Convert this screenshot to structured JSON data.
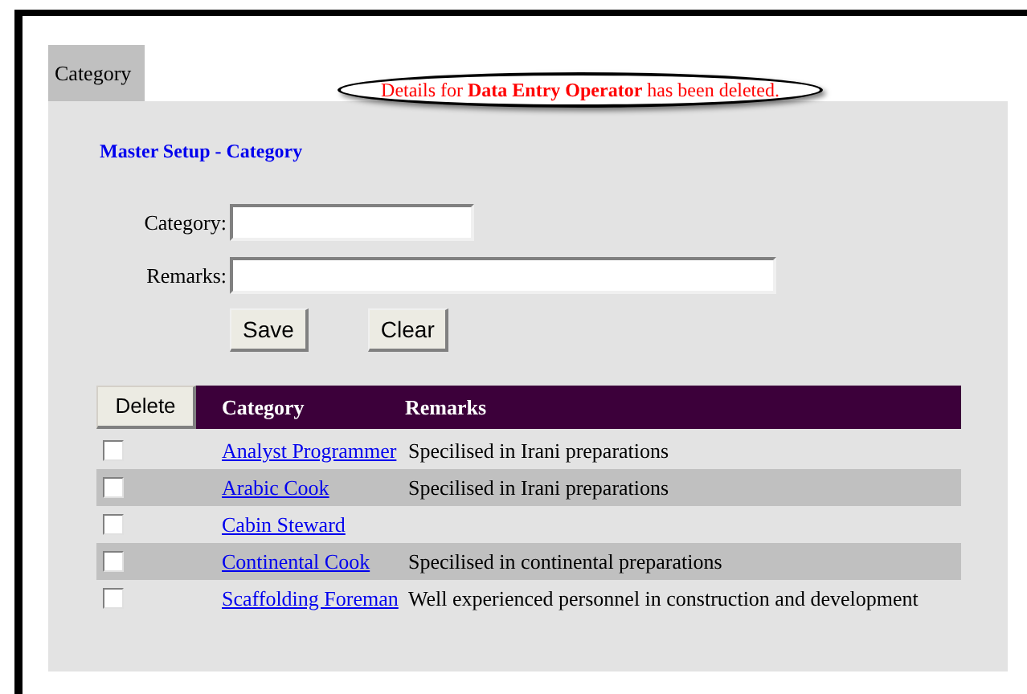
{
  "tabs": [
    {
      "label": "Category",
      "selected": true
    }
  ],
  "message": "Details for **Data Entry Operator** has been deleted.",
  "form": {
    "title": "Master Setup - Category",
    "fields": [
      {
        "label": "Category:",
        "kind": "short"
      },
      {
        "label": "Remarks:",
        "kind": "long"
      }
    ],
    "buttons": [
      "Save",
      "Clear"
    ]
  },
  "table": {
    "delete_button": "Delete",
    "columns": [
      "Category",
      "Remarks"
    ],
    "rows": [
      {
        "checked": false,
        "category": "Analyst Programmer",
        "remarks": "Specilised in Irani preparations"
      },
      {
        "checked": false,
        "category": "Arabic Cook",
        "remarks": "Specilised in Irani preparations"
      },
      {
        "checked": false,
        "category": "Cabin Steward"
      },
      {
        "checked": false,
        "category": "Continental Cook",
        "remarks": "Specilised in continental preparations"
      },
      {
        "checked": false,
        "category": "Scaffolding Foreman",
        "remarks": "Well experienced personnel in construction and development"
      }
    ]
  }
}
